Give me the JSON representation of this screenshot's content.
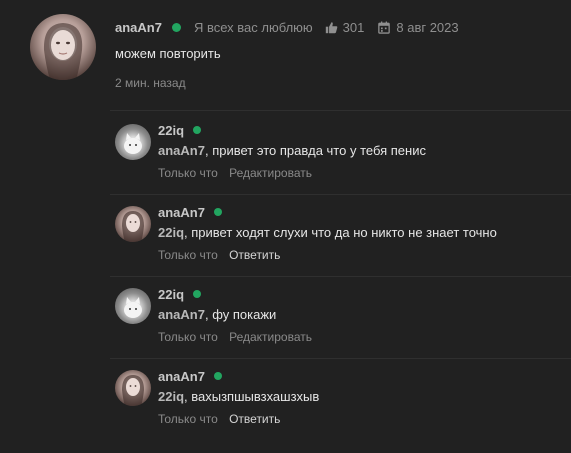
{
  "main_comment": {
    "username": "anaAn7",
    "status": "Я всех вас люблюю",
    "likes": "301",
    "date": "8 авг 2023",
    "text": "можем повторить",
    "time": "2 мин. назад"
  },
  "replies": [
    {
      "username": "22iq",
      "mention": "anaAn7",
      "text": ", привет это правда что у тебя пенис",
      "time": "Только что",
      "action": "Редактировать"
    },
    {
      "username": "anaAn7",
      "mention": "22iq",
      "text": ", привет ходят слухи что да но никто не знает точно",
      "time": "Только что",
      "action": "Ответить"
    },
    {
      "username": "22iq",
      "mention": "anaAn7",
      "text": ", фу покажи",
      "time": "Только что",
      "action": "Редактировать"
    },
    {
      "username": "anaAn7",
      "mention": "22iq",
      "text": ", вахызпшывзхашзхыв",
      "time": "Только что",
      "action": "Ответить"
    }
  ],
  "colors": {
    "background": "#212121",
    "online": "#22a560",
    "muted": "#8a8a8a"
  },
  "icons": {
    "like": "thumbs-up-icon",
    "date": "calendar-icon"
  }
}
